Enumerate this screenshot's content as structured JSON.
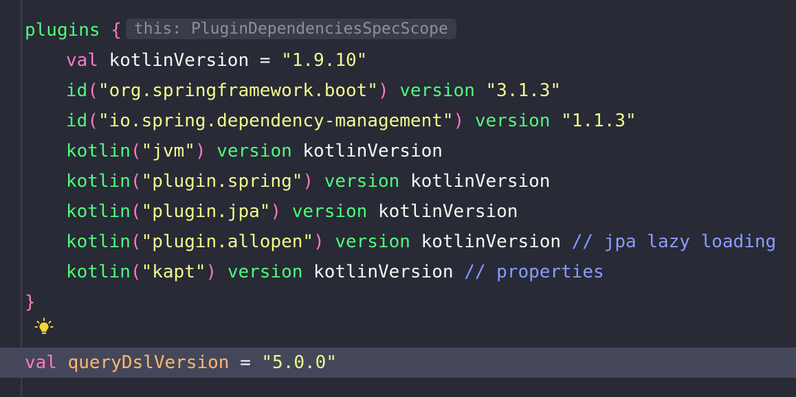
{
  "code": {
    "line1": {
      "fn": "plugins",
      "brace": "{",
      "hint": "this: PluginDependenciesSpecScope"
    },
    "line2": {
      "kw": "val",
      "name": "kotlinVersion",
      "op": " = ",
      "value": "\"1.9.10\""
    },
    "line3": {
      "fn": "id",
      "open": "(",
      "arg": "\"org.springframework.boot\"",
      "close": ")",
      "version_kw": "version",
      "value": "\"3.1.3\""
    },
    "line4": {
      "fn": "id",
      "open": "(",
      "arg": "\"io.spring.dependency-management\"",
      "close": ")",
      "version_kw": "version",
      "value": "\"1.1.3\""
    },
    "line5": {
      "fn": "kotlin",
      "open": "(",
      "arg": "\"jvm\"",
      "close": ")",
      "version_kw": "version",
      "value": "kotlinVersion"
    },
    "line6": {
      "fn": "kotlin",
      "open": "(",
      "arg": "\"plugin.spring\"",
      "close": ")",
      "version_kw": "version",
      "value": "kotlinVersion"
    },
    "line7": {
      "fn": "kotlin",
      "open": "(",
      "arg": "\"plugin.jpa\"",
      "close": ")",
      "version_kw": "version",
      "value": "kotlinVersion"
    },
    "line8": {
      "fn": "kotlin",
      "open": "(",
      "arg": "\"plugin.allopen\"",
      "close": ")",
      "version_kw": "version",
      "value": "kotlinVersion",
      "comment": "// jpa lazy loading"
    },
    "line9": {
      "fn": "kotlin",
      "open": "(",
      "arg": "\"kapt\"",
      "close": ")",
      "version_kw": "version",
      "value": "kotlinVersion",
      "comment": "// properties"
    },
    "line10": {
      "brace": "}"
    },
    "line12": {
      "kw": "val",
      "name": "queryDslVersion",
      "op": " = ",
      "value": "\"5.0.0\""
    }
  },
  "icons": {
    "bulb": "lightbulb-icon"
  },
  "colors": {
    "background": "#282a36",
    "current_line": "#44475a",
    "keyword": "#ff79c6",
    "function": "#50fa7b",
    "string": "#f1fa8c",
    "comment": "#8a9cff",
    "definition": "#ffb86c",
    "hint_text": "#8c8f9f"
  }
}
